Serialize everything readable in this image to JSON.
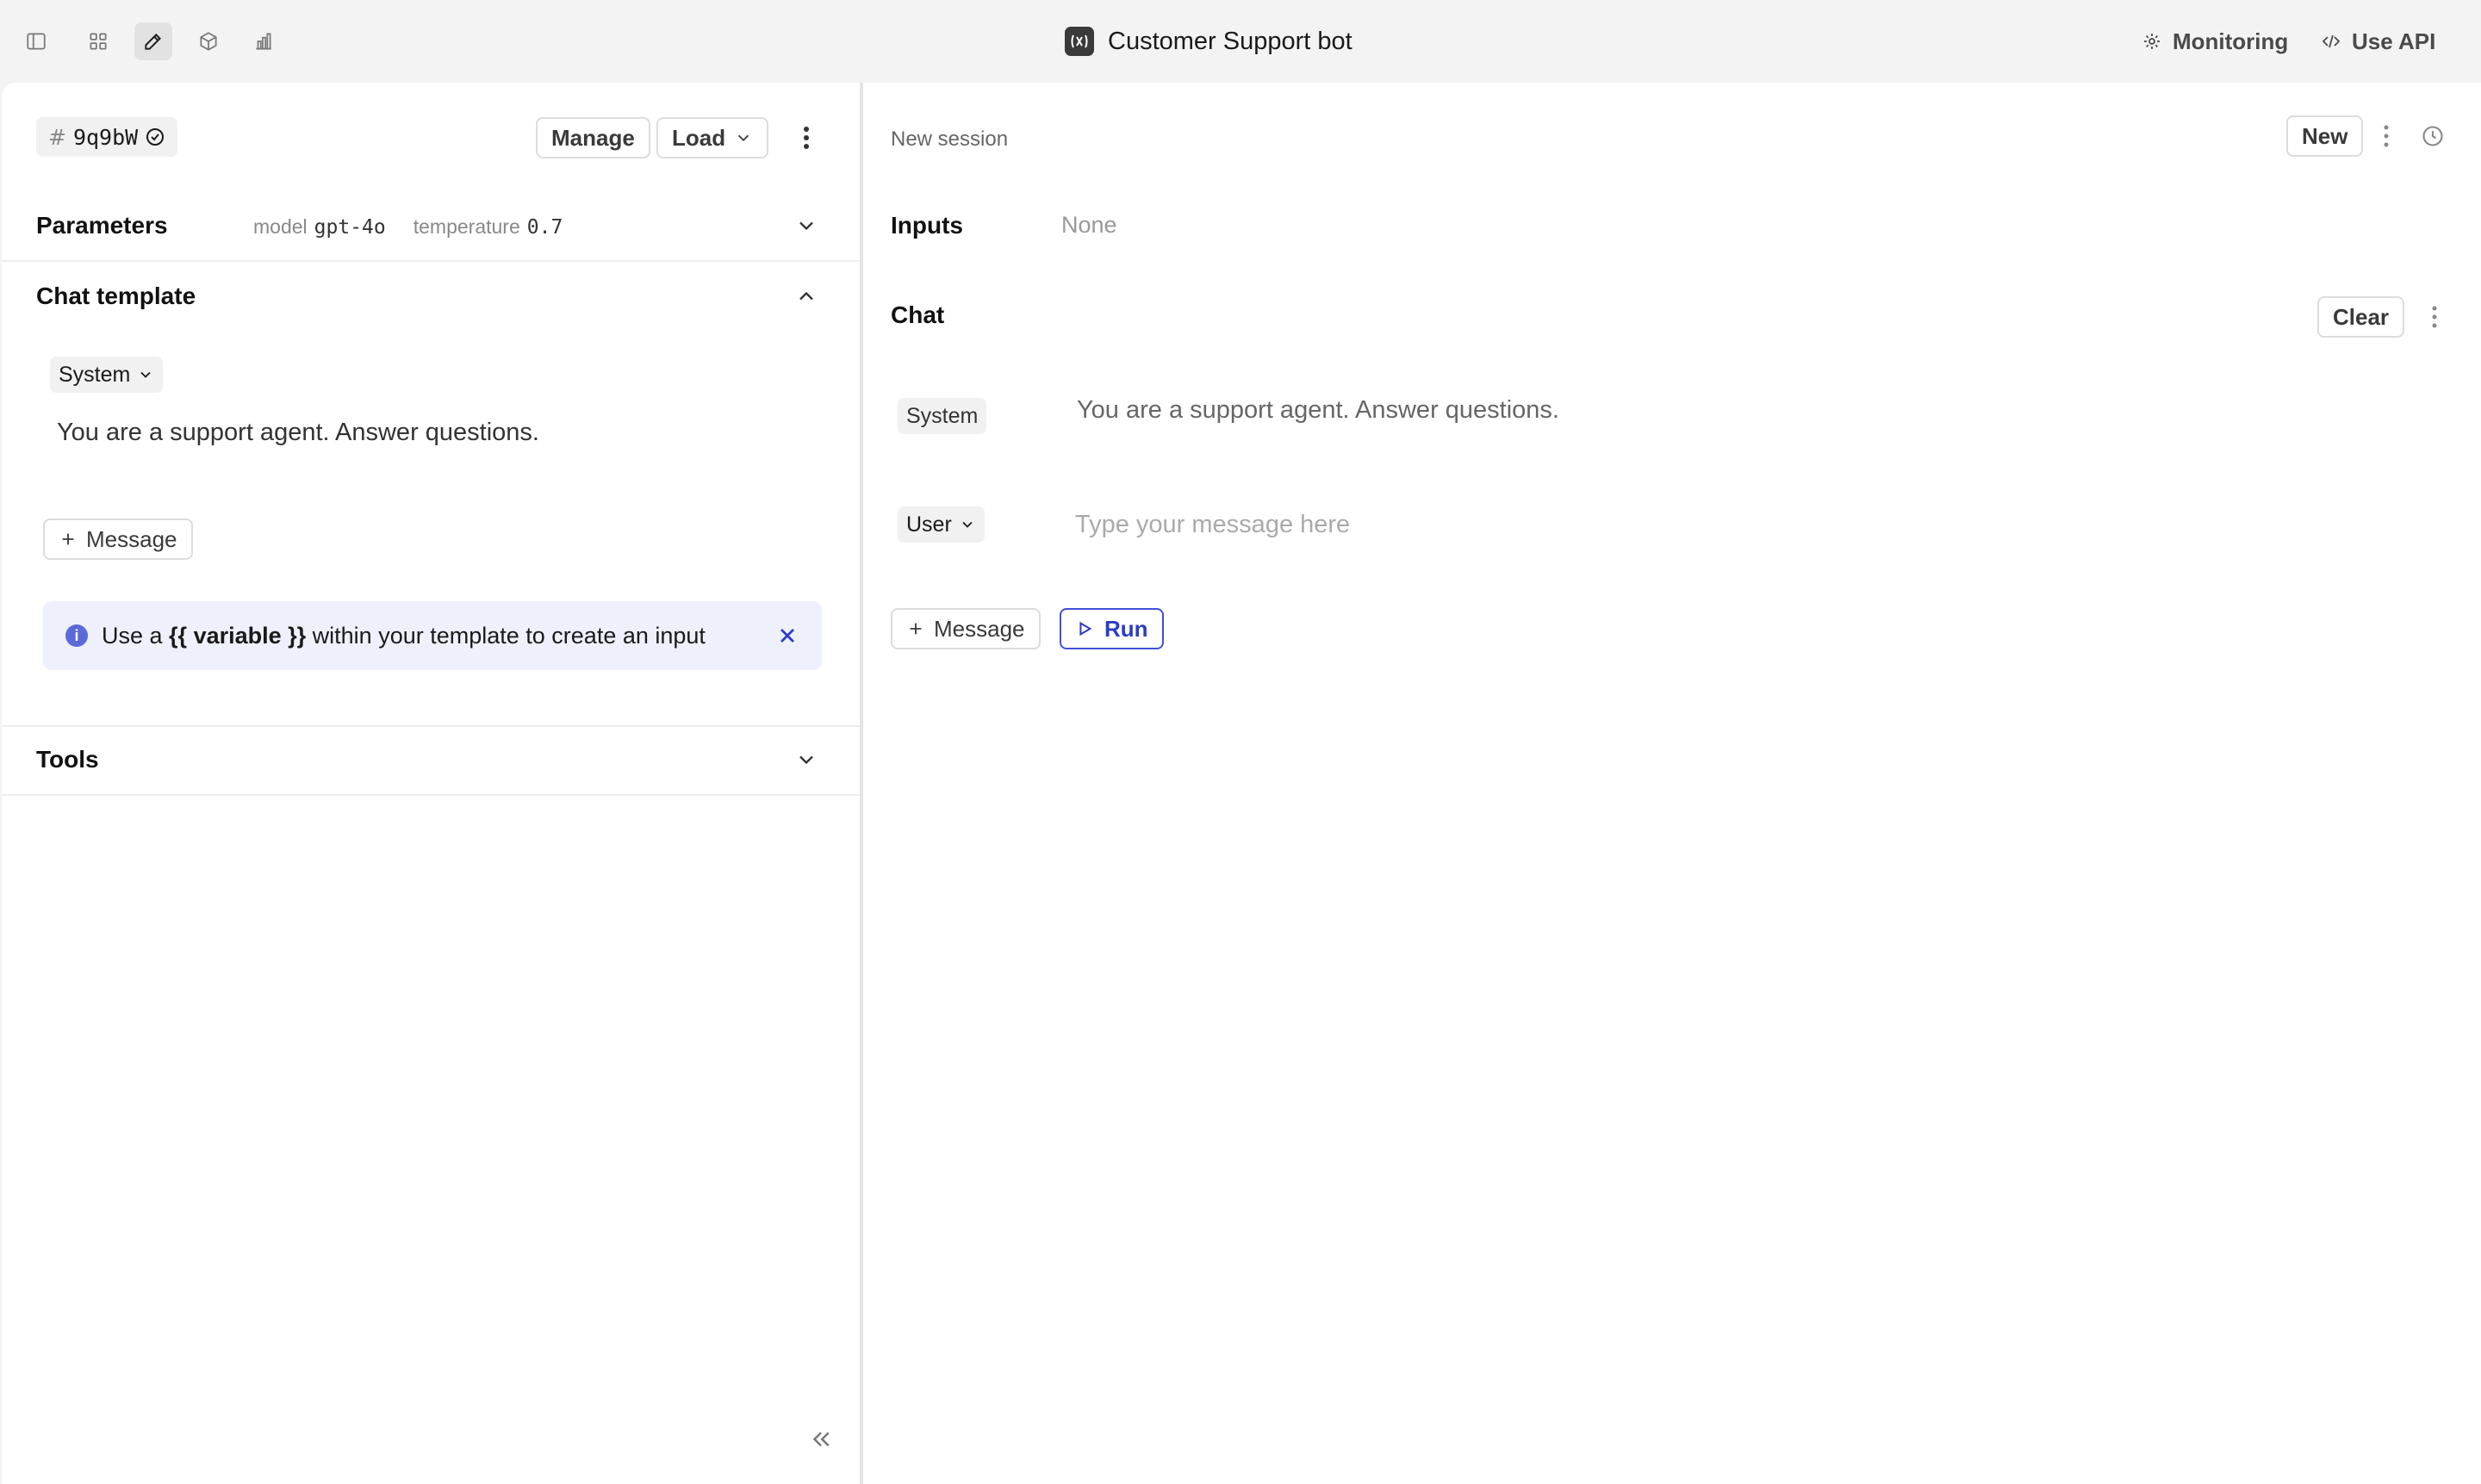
{
  "topbar": {
    "title": "Customer Support bot",
    "icons": [
      "sidebar-toggle-icon",
      "grid-icon",
      "pencil-icon",
      "cube-icon",
      "bar-chart-icon"
    ],
    "active_icon": "pencil-icon",
    "monitoring_label": "Monitoring",
    "use_api_label": "Use API"
  },
  "editor": {
    "version": {
      "hash": "#",
      "id": "9q9bW"
    },
    "manage_label": "Manage",
    "load_label": "Load",
    "parameters": {
      "title": "Parameters",
      "model_label": "model",
      "model_value": "gpt-4o",
      "temperature_label": "temperature",
      "temperature_value": "0.7"
    },
    "chat_template": {
      "title": "Chat template",
      "role": "System",
      "content": "You are a support agent. Answer questions.",
      "add_message_label": "Message"
    },
    "info_banner": {
      "prefix": "Use a ",
      "highlight": "{{ variable }}",
      "suffix": " within your template to create an input"
    },
    "tools": {
      "title": "Tools"
    }
  },
  "session": {
    "title": "New session",
    "new_label": "New",
    "inputs": {
      "title": "Inputs",
      "value": "None"
    },
    "chat": {
      "title": "Chat",
      "clear_label": "Clear",
      "messages": [
        {
          "role": "System",
          "content": "You are a support agent. Answer questions."
        }
      ],
      "user_role": "User",
      "input_placeholder": "Type your message here",
      "add_message_label": "Message",
      "run_label": "Run"
    }
  },
  "colors": {
    "accent": "#2c3cc4",
    "banner_bg": "#eef1fc",
    "app_bg": "#f3f3f3"
  }
}
